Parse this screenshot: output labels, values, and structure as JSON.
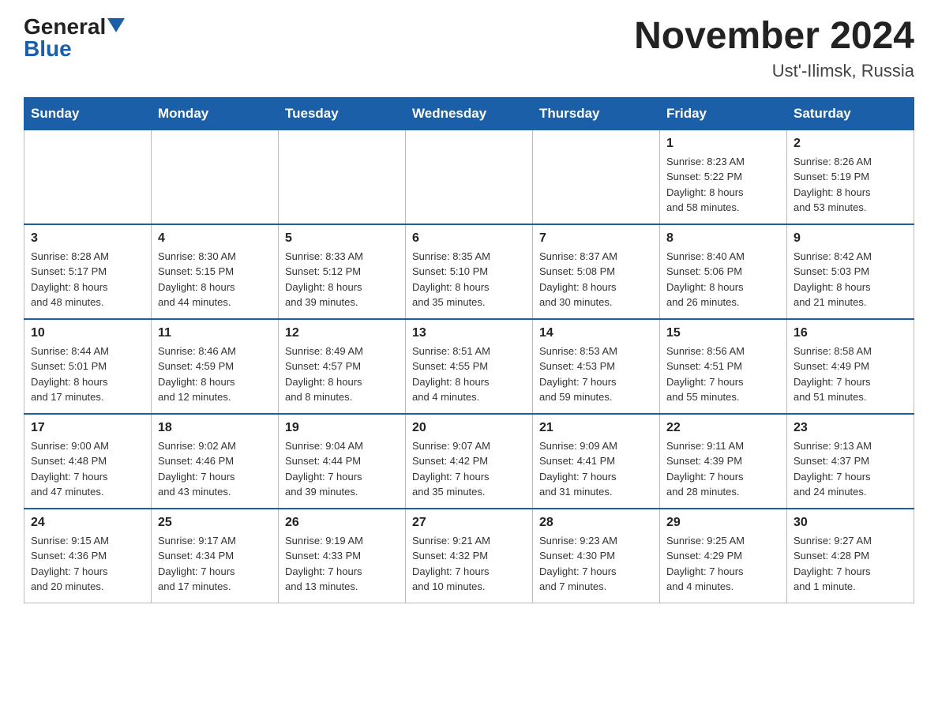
{
  "header": {
    "logo_general": "General",
    "logo_blue": "Blue",
    "month_title": "November 2024",
    "location": "Ust'-Ilimsk, Russia"
  },
  "days_of_week": [
    "Sunday",
    "Monday",
    "Tuesday",
    "Wednesday",
    "Thursday",
    "Friday",
    "Saturday"
  ],
  "weeks": [
    {
      "days": [
        {
          "num": "",
          "info": ""
        },
        {
          "num": "",
          "info": ""
        },
        {
          "num": "",
          "info": ""
        },
        {
          "num": "",
          "info": ""
        },
        {
          "num": "",
          "info": ""
        },
        {
          "num": "1",
          "info": "Sunrise: 8:23 AM\nSunset: 5:22 PM\nDaylight: 8 hours\nand 58 minutes."
        },
        {
          "num": "2",
          "info": "Sunrise: 8:26 AM\nSunset: 5:19 PM\nDaylight: 8 hours\nand 53 minutes."
        }
      ]
    },
    {
      "days": [
        {
          "num": "3",
          "info": "Sunrise: 8:28 AM\nSunset: 5:17 PM\nDaylight: 8 hours\nand 48 minutes."
        },
        {
          "num": "4",
          "info": "Sunrise: 8:30 AM\nSunset: 5:15 PM\nDaylight: 8 hours\nand 44 minutes."
        },
        {
          "num": "5",
          "info": "Sunrise: 8:33 AM\nSunset: 5:12 PM\nDaylight: 8 hours\nand 39 minutes."
        },
        {
          "num": "6",
          "info": "Sunrise: 8:35 AM\nSunset: 5:10 PM\nDaylight: 8 hours\nand 35 minutes."
        },
        {
          "num": "7",
          "info": "Sunrise: 8:37 AM\nSunset: 5:08 PM\nDaylight: 8 hours\nand 30 minutes."
        },
        {
          "num": "8",
          "info": "Sunrise: 8:40 AM\nSunset: 5:06 PM\nDaylight: 8 hours\nand 26 minutes."
        },
        {
          "num": "9",
          "info": "Sunrise: 8:42 AM\nSunset: 5:03 PM\nDaylight: 8 hours\nand 21 minutes."
        }
      ]
    },
    {
      "days": [
        {
          "num": "10",
          "info": "Sunrise: 8:44 AM\nSunset: 5:01 PM\nDaylight: 8 hours\nand 17 minutes."
        },
        {
          "num": "11",
          "info": "Sunrise: 8:46 AM\nSunset: 4:59 PM\nDaylight: 8 hours\nand 12 minutes."
        },
        {
          "num": "12",
          "info": "Sunrise: 8:49 AM\nSunset: 4:57 PM\nDaylight: 8 hours\nand 8 minutes."
        },
        {
          "num": "13",
          "info": "Sunrise: 8:51 AM\nSunset: 4:55 PM\nDaylight: 8 hours\nand 4 minutes."
        },
        {
          "num": "14",
          "info": "Sunrise: 8:53 AM\nSunset: 4:53 PM\nDaylight: 7 hours\nand 59 minutes."
        },
        {
          "num": "15",
          "info": "Sunrise: 8:56 AM\nSunset: 4:51 PM\nDaylight: 7 hours\nand 55 minutes."
        },
        {
          "num": "16",
          "info": "Sunrise: 8:58 AM\nSunset: 4:49 PM\nDaylight: 7 hours\nand 51 minutes."
        }
      ]
    },
    {
      "days": [
        {
          "num": "17",
          "info": "Sunrise: 9:00 AM\nSunset: 4:48 PM\nDaylight: 7 hours\nand 47 minutes."
        },
        {
          "num": "18",
          "info": "Sunrise: 9:02 AM\nSunset: 4:46 PM\nDaylight: 7 hours\nand 43 minutes."
        },
        {
          "num": "19",
          "info": "Sunrise: 9:04 AM\nSunset: 4:44 PM\nDaylight: 7 hours\nand 39 minutes."
        },
        {
          "num": "20",
          "info": "Sunrise: 9:07 AM\nSunset: 4:42 PM\nDaylight: 7 hours\nand 35 minutes."
        },
        {
          "num": "21",
          "info": "Sunrise: 9:09 AM\nSunset: 4:41 PM\nDaylight: 7 hours\nand 31 minutes."
        },
        {
          "num": "22",
          "info": "Sunrise: 9:11 AM\nSunset: 4:39 PM\nDaylight: 7 hours\nand 28 minutes."
        },
        {
          "num": "23",
          "info": "Sunrise: 9:13 AM\nSunset: 4:37 PM\nDaylight: 7 hours\nand 24 minutes."
        }
      ]
    },
    {
      "days": [
        {
          "num": "24",
          "info": "Sunrise: 9:15 AM\nSunset: 4:36 PM\nDaylight: 7 hours\nand 20 minutes."
        },
        {
          "num": "25",
          "info": "Sunrise: 9:17 AM\nSunset: 4:34 PM\nDaylight: 7 hours\nand 17 minutes."
        },
        {
          "num": "26",
          "info": "Sunrise: 9:19 AM\nSunset: 4:33 PM\nDaylight: 7 hours\nand 13 minutes."
        },
        {
          "num": "27",
          "info": "Sunrise: 9:21 AM\nSunset: 4:32 PM\nDaylight: 7 hours\nand 10 minutes."
        },
        {
          "num": "28",
          "info": "Sunrise: 9:23 AM\nSunset: 4:30 PM\nDaylight: 7 hours\nand 7 minutes."
        },
        {
          "num": "29",
          "info": "Sunrise: 9:25 AM\nSunset: 4:29 PM\nDaylight: 7 hours\nand 4 minutes."
        },
        {
          "num": "30",
          "info": "Sunrise: 9:27 AM\nSunset: 4:28 PM\nDaylight: 7 hours\nand 1 minute."
        }
      ]
    }
  ]
}
